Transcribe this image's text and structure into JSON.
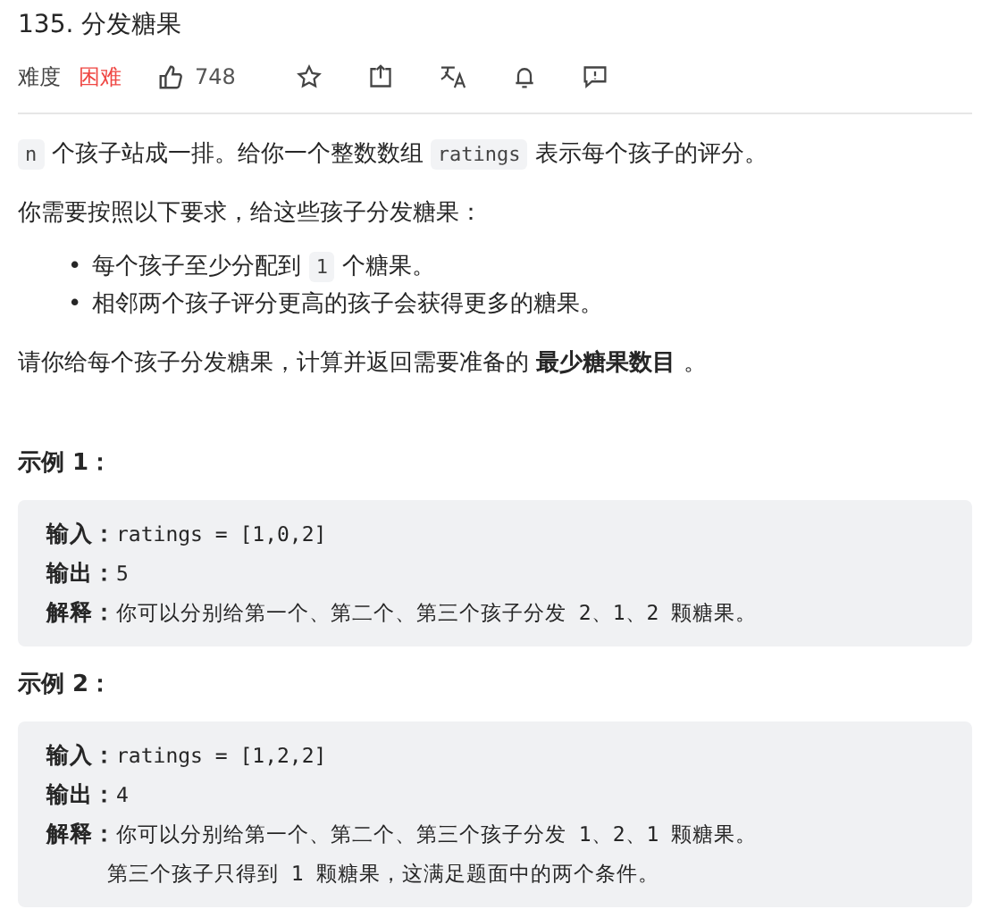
{
  "title": "135. 分发糖果",
  "meta": {
    "difficulty_label": "难度",
    "difficulty": "困难",
    "likes": "748"
  },
  "paragraphs": [
    {
      "kind": "para",
      "segments": [
        {
          "kind": "code",
          "text": "n"
        },
        {
          "kind": "text",
          "text": " 个孩子站成一排。给你一个整数数组 "
        },
        {
          "kind": "code",
          "text": "ratings"
        },
        {
          "kind": "text",
          "text": " 表示每个孩子的评分。"
        }
      ]
    },
    {
      "kind": "para",
      "segments": [
        {
          "kind": "text",
          "text": "你需要按照以下要求，给这些孩子分发糖果："
        }
      ]
    },
    {
      "kind": "bullets",
      "items": [
        {
          "bullet": "•",
          "segments": [
            {
              "kind": "text",
              "text": "每个孩子至少分配到 "
            },
            {
              "kind": "code",
              "text": "1"
            },
            {
              "kind": "text",
              "text": " 个糖果。"
            }
          ]
        },
        {
          "bullet": "•",
          "segments": [
            {
              "kind": "text",
              "text": "相邻两个孩子评分更高的孩子会获得更多的糖果。"
            }
          ]
        }
      ]
    },
    {
      "kind": "para",
      "segments": [
        {
          "kind": "text",
          "text": "请你给每个孩子分发糖果，计算并返回需要准备的 **最少糖果数目** 。"
        }
      ]
    }
  ],
  "examples": [
    {
      "heading": "示例 1：",
      "lines": [
        {
          "label": "输入：",
          "value": "ratings = [1,0,2]"
        },
        {
          "label": "输出：",
          "value": "5"
        },
        {
          "label": "解释：",
          "value": "你可以分别给第一个、第二个、第三个孩子分发 2、1、2 颗糖果。"
        }
      ]
    },
    {
      "heading": "示例 2：",
      "lines": [
        {
          "label": "输入：",
          "value": "ratings = [1,2,2]"
        },
        {
          "label": "输出：",
          "value": "4"
        },
        {
          "label": "解释：",
          "value": "你可以分别给第一个、第二个、第三个孩子分发 1、2、1 颗糖果。"
        },
        {
          "value": "第三个孩子只得到 1 颗糖果，这满足题面中的两个条件。"
        }
      ]
    }
  ]
}
